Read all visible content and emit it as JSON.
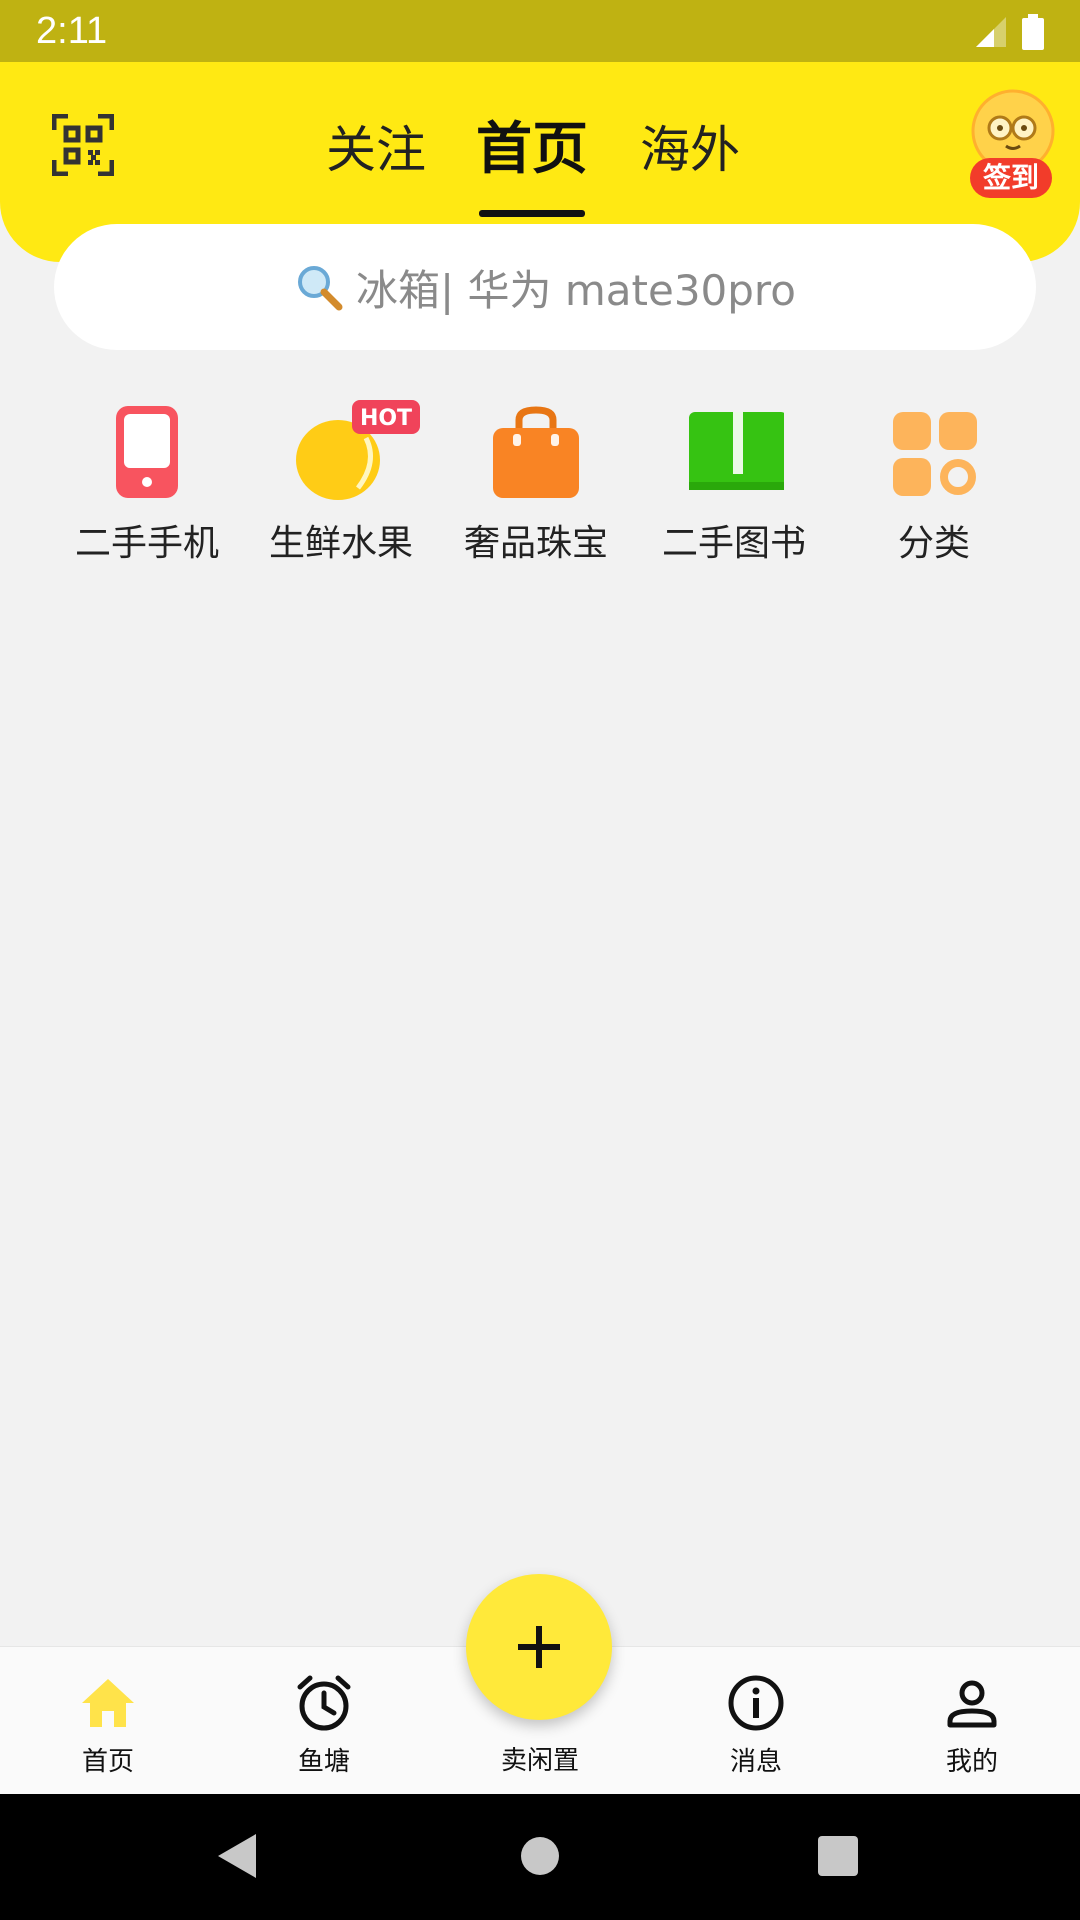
{
  "status_bar": {
    "time": "2:11"
  },
  "header": {
    "tabs": [
      {
        "label": "关注"
      },
      {
        "label": "首页"
      },
      {
        "label": "海外"
      }
    ],
    "signin_label": "签到"
  },
  "search": {
    "placeholder": "冰箱| 华为 mate30pro"
  },
  "categories": [
    {
      "label": "二手手机",
      "icon": "phone-icon",
      "color": "#f8545f"
    },
    {
      "label": "生鲜水果",
      "icon": "lemon-icon",
      "color": "#ffcc16",
      "badge": "HOT"
    },
    {
      "label": "奢品珠宝",
      "icon": "bag-icon",
      "color": "#f98424"
    },
    {
      "label": "二手图书",
      "icon": "book-icon",
      "color": "#36c312"
    },
    {
      "label": "分类",
      "icon": "grid-icon",
      "color": "#fdb45b"
    }
  ],
  "bottom_nav": {
    "items": [
      {
        "label": "首页",
        "icon": "home-icon"
      },
      {
        "label": "鱼塘",
        "icon": "alarm-clock-icon"
      },
      {
        "label": "卖闲置",
        "icon": "plus-icon"
      },
      {
        "label": "消息",
        "icon": "info-icon"
      },
      {
        "label": "我的",
        "icon": "person-icon"
      }
    ]
  },
  "colors": {
    "brand_yellow": "#ffe913",
    "status_bar": "#bfb212",
    "fab": "#ffe93a",
    "active_nav": "#ffe34a"
  }
}
